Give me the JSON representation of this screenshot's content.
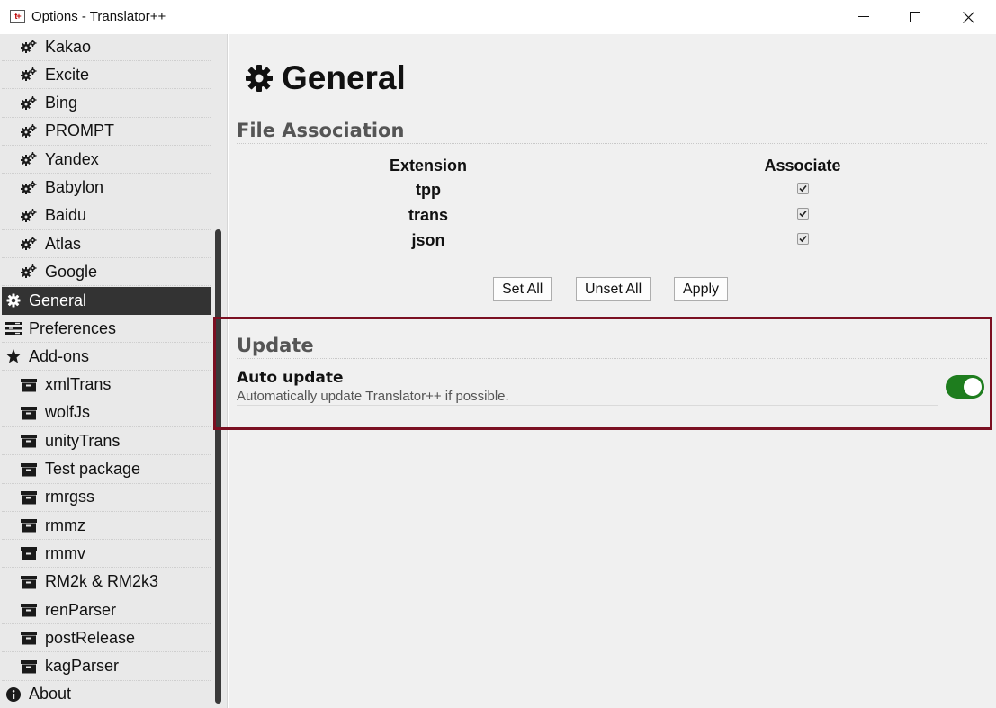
{
  "window": {
    "app_icon_text": "t+",
    "title": "Options - Translator++"
  },
  "sidebar": {
    "items": [
      {
        "label": "Kakao",
        "icon": "gears-icon",
        "level": "child"
      },
      {
        "label": "Excite",
        "icon": "gears-icon",
        "level": "child"
      },
      {
        "label": "Bing",
        "icon": "gears-icon",
        "level": "child"
      },
      {
        "label": "PROMPT",
        "icon": "gears-icon",
        "level": "child"
      },
      {
        "label": "Yandex",
        "icon": "gears-icon",
        "level": "child"
      },
      {
        "label": "Babylon",
        "icon": "gears-icon",
        "level": "child"
      },
      {
        "label": "Baidu",
        "icon": "gears-icon",
        "level": "child"
      },
      {
        "label": "Atlas",
        "icon": "gears-icon",
        "level": "child"
      },
      {
        "label": "Google",
        "icon": "gears-icon",
        "level": "child"
      },
      {
        "label": "General",
        "icon": "gear-icon",
        "level": "top",
        "active": true
      },
      {
        "label": "Preferences",
        "icon": "preferences-icon",
        "level": "top"
      },
      {
        "label": "Add-ons",
        "icon": "puzzle-icon",
        "level": "top"
      },
      {
        "label": "xmlTrans",
        "icon": "archive-icon",
        "level": "child"
      },
      {
        "label": "wolfJs",
        "icon": "archive-icon",
        "level": "child"
      },
      {
        "label": "unityTrans",
        "icon": "archive-icon",
        "level": "child"
      },
      {
        "label": "Test package",
        "icon": "archive-icon",
        "level": "child"
      },
      {
        "label": "rmrgss",
        "icon": "archive-icon",
        "level": "child"
      },
      {
        "label": "rmmz",
        "icon": "archive-icon",
        "level": "child"
      },
      {
        "label": "rmmv",
        "icon": "archive-icon",
        "level": "child"
      },
      {
        "label": "RM2k & RM2k3",
        "icon": "archive-icon",
        "level": "child"
      },
      {
        "label": "renParser",
        "icon": "archive-icon",
        "level": "child"
      },
      {
        "label": "postRelease",
        "icon": "archive-icon",
        "level": "child"
      },
      {
        "label": "kagParser",
        "icon": "archive-icon",
        "level": "child"
      },
      {
        "label": "About",
        "icon": "info-icon",
        "level": "top"
      }
    ]
  },
  "main": {
    "title": "General",
    "file_association": {
      "heading": "File Association",
      "col_extension": "Extension",
      "col_associate": "Associate",
      "rows": [
        {
          "extension": "tpp",
          "checked": true
        },
        {
          "extension": "trans",
          "checked": true
        },
        {
          "extension": "json",
          "checked": true
        }
      ],
      "buttons": {
        "set_all": "Set All",
        "unset_all": "Unset All",
        "apply": "Apply"
      }
    },
    "update": {
      "heading": "Update",
      "auto_update_label": "Auto update",
      "auto_update_desc": "Automatically update Translator++ if possible.",
      "auto_update_on": true
    }
  },
  "colors": {
    "active_item_bg": "#333333",
    "toggle_on": "#1e7d1e",
    "highlight_border": "#7b1022"
  }
}
